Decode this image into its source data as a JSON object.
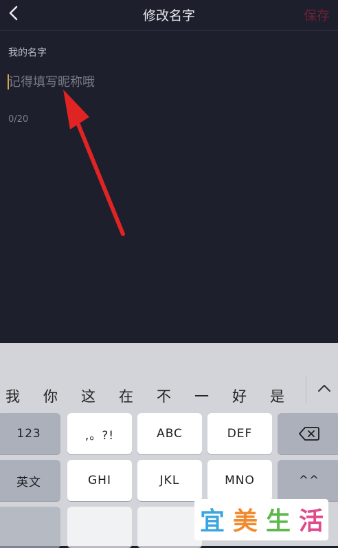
{
  "navbar": {
    "title": "修改名字",
    "save_label": "保存"
  },
  "form": {
    "section_label": "我的名字",
    "input_placeholder": "记得填写昵称哦",
    "input_value": "",
    "char_count": "0/20"
  },
  "keyboard": {
    "candidates": [
      "我",
      "你",
      "这",
      "在",
      "不",
      "一",
      "好",
      "是"
    ],
    "rows": [
      [
        "123",
        ",。?!",
        "ABC",
        "DEF"
      ],
      [
        "英文",
        "GHI",
        "JKL",
        "MNO",
        "^^"
      ]
    ]
  },
  "watermark": {
    "chars": [
      "宜",
      "美",
      "生",
      "活"
    ],
    "colors": [
      "#3aa5e0",
      "#f08a2c",
      "#5cb84a",
      "#e04a8c"
    ]
  },
  "colors": {
    "app_background": "#1d1f2c",
    "save_disabled": "#6b2236",
    "annotation_arrow": "#e02424",
    "keyboard_background": "#d2d4d9"
  }
}
